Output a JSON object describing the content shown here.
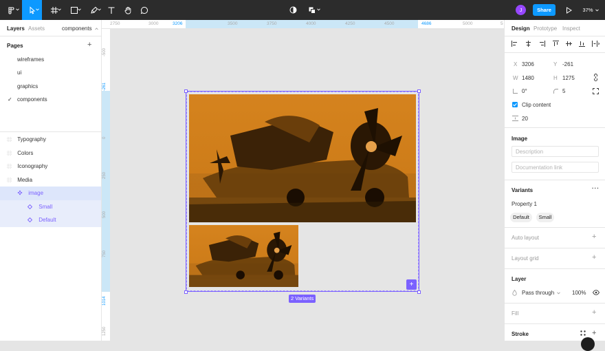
{
  "toolbar": {
    "share_label": "Share",
    "zoom_label": "37%",
    "avatar_initial": "J",
    "accent": "#0d99ff",
    "avatar_color": "#9747ff"
  },
  "left_panel": {
    "tabs": {
      "layers": "Layers",
      "assets": "Assets",
      "file": "components"
    },
    "pages_heading": "Pages",
    "pages": [
      {
        "label": "wireframes"
      },
      {
        "label": "ui"
      },
      {
        "label": "graphics"
      },
      {
        "label": "components",
        "current": true
      }
    ],
    "check_mark": "✓",
    "layers": [
      {
        "label": "Typography"
      },
      {
        "label": "Colors"
      },
      {
        "label": "Iconography"
      },
      {
        "label": "Media"
      },
      {
        "label": "image",
        "selected": true
      },
      {
        "label": "Small"
      },
      {
        "label": "Default"
      }
    ]
  },
  "rulers": {
    "h_ticks": [
      "2750",
      "3000",
      "3206",
      "3500",
      "3750",
      "4000",
      "4250",
      "4500",
      "4686",
      "5000",
      "5"
    ],
    "v_ticks": [
      "-500",
      "-261",
      "0",
      "250",
      "500",
      "750",
      "1014",
      "1250"
    ]
  },
  "canvas": {
    "variants_badge": "2 Variants",
    "selection_color": "#7b61ff",
    "image_tint": "#d17f1c"
  },
  "right_panel": {
    "tabs": {
      "design": "Design",
      "prototype": "Prototype",
      "inspect": "Inspect"
    },
    "x_label": "X",
    "x_value": "3206",
    "y_label": "Y",
    "y_value": "-261",
    "w_label": "W",
    "w_value": "1480",
    "h_label": "H",
    "h_value": "1275",
    "rotation_value": "0°",
    "radius_value": "5",
    "clip_label": "Clip content",
    "gap_value": "20",
    "image_section": "Image",
    "description_placeholder": "Description",
    "doc_link_placeholder": "Documentation link",
    "variants_section": "Variants",
    "property_label": "Property 1",
    "variant_chips": [
      "Default",
      "Small"
    ],
    "auto_layout": "Auto layout",
    "layout_grid": "Layout grid",
    "layer_section": "Layer",
    "blend_mode": "Pass through",
    "opacity": "100%",
    "fill_section": "Fill",
    "stroke_section": "Stroke"
  }
}
